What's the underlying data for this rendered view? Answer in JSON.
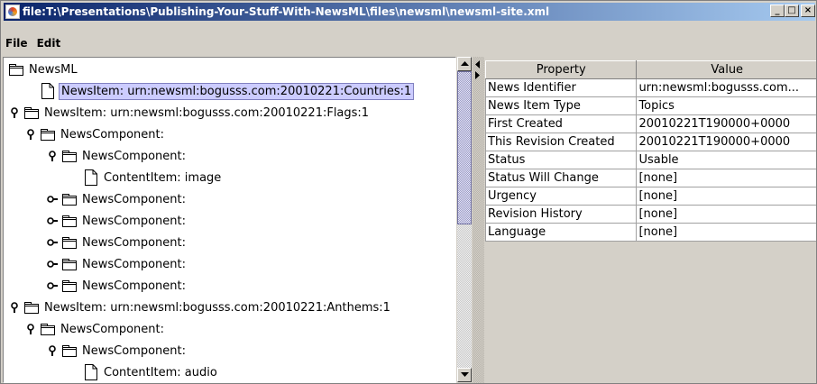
{
  "window": {
    "title": "file:T:\\Presentations\\Publishing-Your-Stuff-With-NewsML\\files\\newsml\\newsml-site.xml",
    "minimize_glyph": "_",
    "maximize_glyph": "□",
    "close_glyph": "×"
  },
  "menu": {
    "items": [
      "File",
      "Edit"
    ]
  },
  "tree": {
    "rows": [
      {
        "label": "NewsML",
        "depth": 0,
        "toggle": "none",
        "icon": "folder",
        "selected": false
      },
      {
        "label": "NewsItem: urn:newsml:bogusss.com:20010221:Countries:1",
        "depth": 1,
        "toggle": "none",
        "icon": "document",
        "selected": true
      },
      {
        "label": "NewsItem: urn:newsml:bogusss.com:20010221:Flags:1",
        "depth": 0,
        "toggle": "expanded",
        "icon": "folder",
        "selected": false
      },
      {
        "label": "NewsComponent:",
        "depth": 1,
        "toggle": "expanded",
        "icon": "folder",
        "selected": false
      },
      {
        "label": "NewsComponent:",
        "depth": 2,
        "toggle": "expanded",
        "icon": "folder",
        "selected": false
      },
      {
        "label": "ContentItem: image",
        "depth": 3,
        "toggle": "none",
        "icon": "document",
        "selected": false
      },
      {
        "label": "NewsComponent:",
        "depth": 2,
        "toggle": "collapsed",
        "icon": "folder",
        "selected": false
      },
      {
        "label": "NewsComponent:",
        "depth": 2,
        "toggle": "collapsed",
        "icon": "folder",
        "selected": false
      },
      {
        "label": "NewsComponent:",
        "depth": 2,
        "toggle": "collapsed",
        "icon": "folder",
        "selected": false
      },
      {
        "label": "NewsComponent:",
        "depth": 2,
        "toggle": "collapsed",
        "icon": "folder",
        "selected": false
      },
      {
        "label": "NewsComponent:",
        "depth": 2,
        "toggle": "collapsed",
        "icon": "folder",
        "selected": false
      },
      {
        "label": "NewsItem: urn:newsml:bogusss.com:20010221:Anthems:1",
        "depth": 0,
        "toggle": "expanded",
        "icon": "folder",
        "selected": false
      },
      {
        "label": "NewsComponent:",
        "depth": 1,
        "toggle": "expanded",
        "icon": "folder",
        "selected": false
      },
      {
        "label": "NewsComponent:",
        "depth": 2,
        "toggle": "expanded",
        "icon": "folder",
        "selected": false
      },
      {
        "label": "ContentItem: audio",
        "depth": 3,
        "toggle": "none",
        "icon": "document",
        "selected": false
      }
    ]
  },
  "properties": {
    "headers": [
      "Property",
      "Value"
    ],
    "rows": [
      [
        "News Identifier",
        "urn:newsml:bogusss.com..."
      ],
      [
        "News Item Type",
        "Topics"
      ],
      [
        "First Created",
        "20010221T190000+0000"
      ],
      [
        "This Revision Created",
        "20010221T190000+0000"
      ],
      [
        "Status",
        "Usable"
      ],
      [
        "Status Will Change",
        "[none]"
      ],
      [
        "Urgency",
        "[none]"
      ],
      [
        "Revision History",
        "[none]"
      ],
      [
        "Language",
        "[none]"
      ]
    ]
  },
  "colors": {
    "title_bar_start": "#0a246a",
    "title_bar_end": "#a6caf0",
    "selection_bg": "#ccccff",
    "face": "#d4d0c8"
  }
}
